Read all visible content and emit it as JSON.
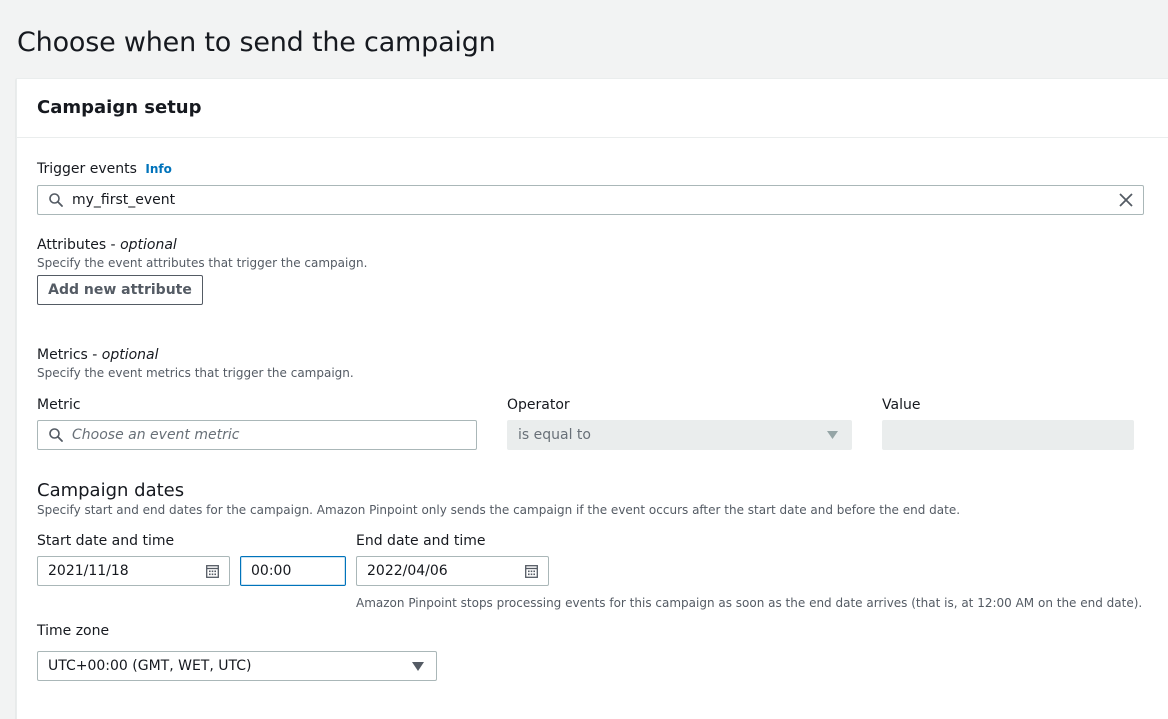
{
  "page": {
    "title": "Choose when to send the campaign"
  },
  "panel": {
    "title": "Campaign setup"
  },
  "trigger": {
    "label": "Trigger events",
    "info": "Info",
    "value": "my_first_event"
  },
  "attributes": {
    "label": "Attributes - ",
    "optional": "optional",
    "description": "Specify the event attributes that trigger the campaign.",
    "add_button": "Add new attribute"
  },
  "metrics": {
    "label": "Metrics - ",
    "optional": "optional",
    "description": "Specify the event metrics that trigger the campaign.",
    "metric_label": "Metric",
    "metric_placeholder": "Choose an event metric",
    "operator_label": "Operator",
    "operator_value": "is equal to",
    "value_label": "Value",
    "value_value": ""
  },
  "dates": {
    "title": "Campaign dates",
    "description": "Specify start and end dates for the campaign. Amazon Pinpoint only sends the campaign if the event occurs after the start date and before the end date.",
    "start_label": "Start date and time",
    "start_date": "2021/11/18",
    "start_time": "00:00",
    "end_label": "End date and time",
    "end_date": "2022/04/06",
    "end_note": "Amazon Pinpoint stops processing events for this campaign as soon as the end date arrives (that is, at 12:00 AM on the end date)."
  },
  "timezone": {
    "label": "Time zone",
    "value": "UTC+00:00 (GMT, WET, UTC)"
  },
  "icons": {
    "search": "search-icon",
    "clear": "close-icon",
    "calendar": "calendar-icon",
    "dropdown": "caret-down-icon"
  },
  "colors": {
    "background": "#f2f3f3",
    "link": "#0073bb",
    "focus": "#0073bb",
    "disabled": "#eaeded"
  }
}
